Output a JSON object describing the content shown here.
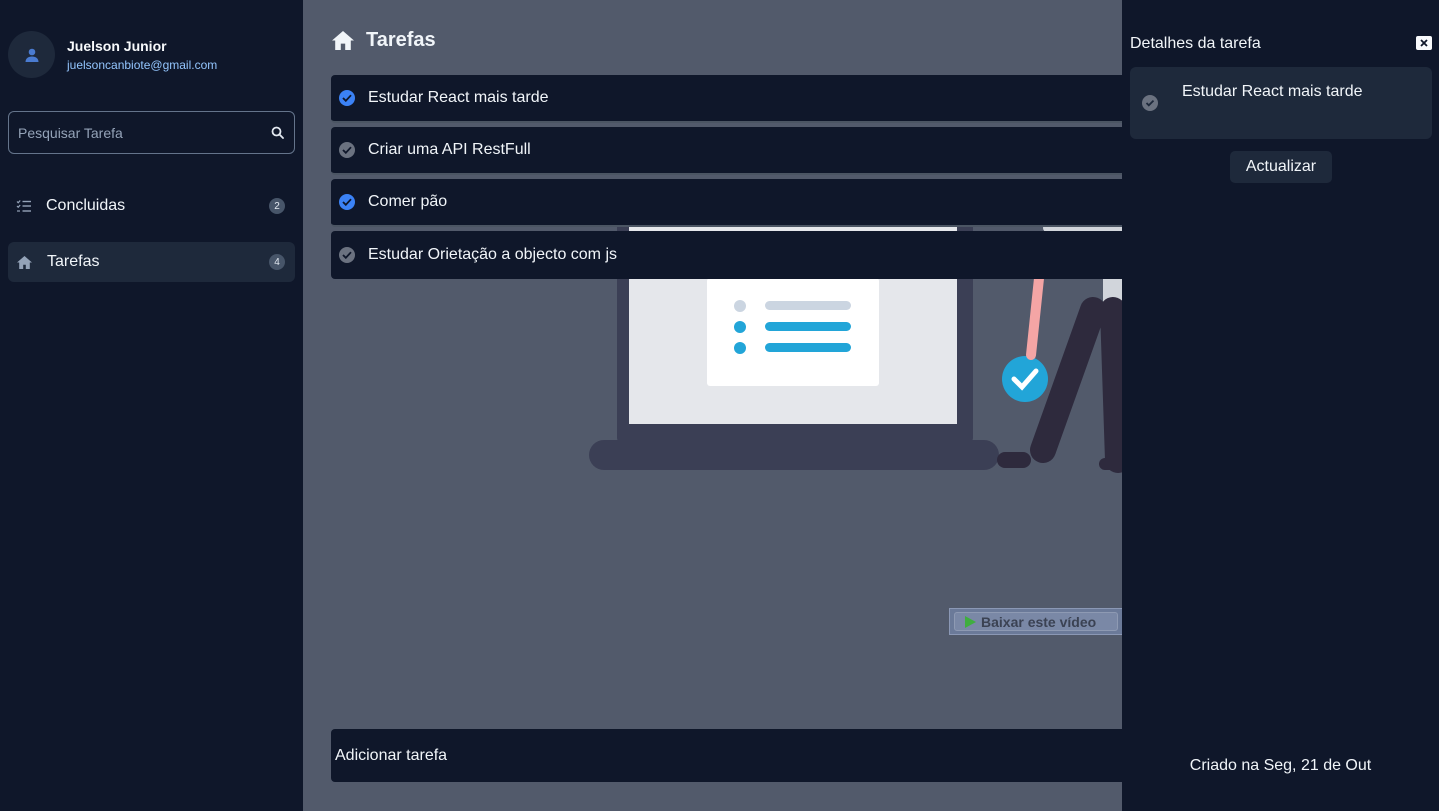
{
  "user": {
    "name": "Juelson Junior",
    "email": "juelsoncanbiote@gmail.com"
  },
  "search": {
    "placeholder": "Pesquisar Tarefa"
  },
  "sidebar": {
    "items": [
      {
        "label": "Concluidas",
        "count": "2"
      },
      {
        "label": "Tarefas",
        "count": "4"
      }
    ]
  },
  "main": {
    "title": "Tarefas",
    "tasks": [
      {
        "label": "Estudar React mais tarde",
        "done": true
      },
      {
        "label": "Criar uma API RestFull",
        "done": false
      },
      {
        "label": "Comer pão",
        "done": true
      },
      {
        "label": "Estudar Orietação a objecto com js",
        "done": false
      }
    ],
    "add_placeholder": "Adicionar tarefa"
  },
  "extension": {
    "label": "Baixar este vídeo",
    "help": "?",
    "close": "X"
  },
  "details": {
    "title": "Detalhes da tarefa",
    "task": "Estudar React mais tarde",
    "update_label": "Actualizar",
    "created": "Criado na Seg, 21 de Out"
  },
  "colors": {
    "done_check": "#3b82f6",
    "pending_check": "#6b7280",
    "main_bg": "#525a6b",
    "panel_bg": "#0f172a"
  }
}
